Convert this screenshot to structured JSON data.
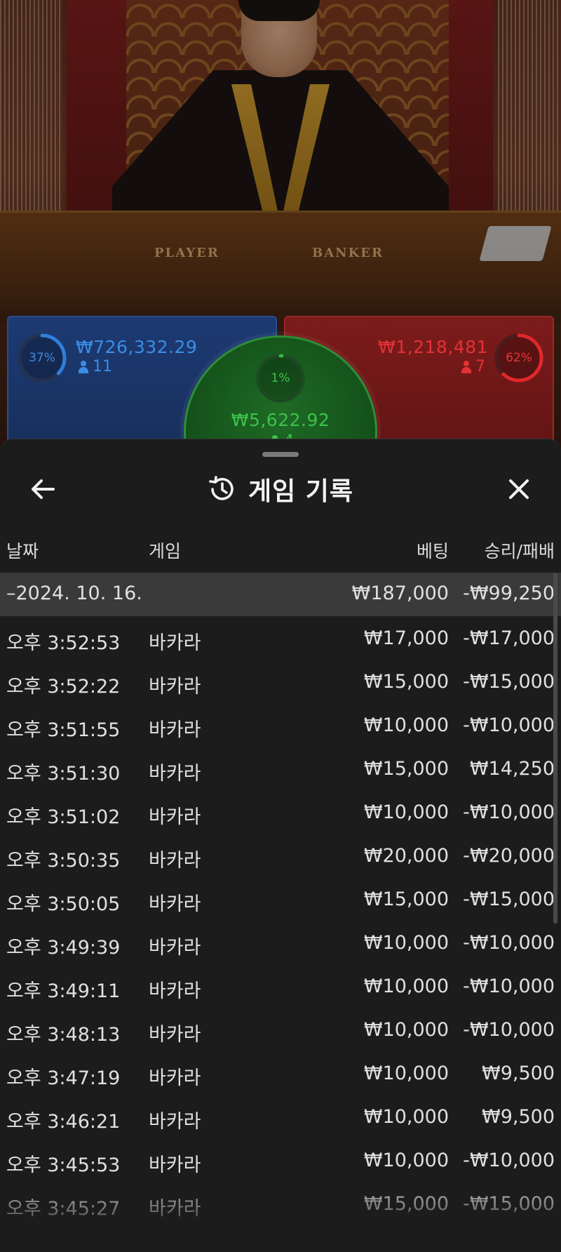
{
  "video": {
    "table_label_player": "PLAYER",
    "table_label_banker": "BANKER"
  },
  "bets": {
    "player": {
      "percent": "37%",
      "percent_value": 37,
      "amount": "₩726,332.29",
      "count": "11",
      "color": "#2f7fd9"
    },
    "tie": {
      "percent": "1%",
      "percent_value": 1,
      "amount": "₩5,622.92",
      "count": "4",
      "color": "#32b83e"
    },
    "banker": {
      "percent": "62%",
      "percent_value": 62,
      "amount": "₩1,218,481",
      "count": "7",
      "color": "#e0282c"
    }
  },
  "history": {
    "title": "게임 기록",
    "icons": {
      "back": "arrow-left-icon",
      "history": "history-clock-icon",
      "close": "close-icon"
    },
    "columns": {
      "date": "날짜",
      "game": "게임",
      "bet": "베팅",
      "winloss": "승리/패배"
    },
    "group": {
      "date": "–2024. 10. 16.",
      "bet": "₩187,000",
      "winloss": "-₩99,250"
    },
    "rows": [
      {
        "time": "오후 3:52:53",
        "game": "바카라",
        "bet": "₩17,000",
        "winloss": "-₩17,000"
      },
      {
        "time": "오후 3:52:22",
        "game": "바카라",
        "bet": "₩15,000",
        "winloss": "-₩15,000"
      },
      {
        "time": "오후 3:51:55",
        "game": "바카라",
        "bet": "₩10,000",
        "winloss": "-₩10,000"
      },
      {
        "time": "오후 3:51:30",
        "game": "바카라",
        "bet": "₩15,000",
        "winloss": "₩14,250"
      },
      {
        "time": "오후 3:51:02",
        "game": "바카라",
        "bet": "₩10,000",
        "winloss": "-₩10,000"
      },
      {
        "time": "오후 3:50:35",
        "game": "바카라",
        "bet": "₩20,000",
        "winloss": "-₩20,000"
      },
      {
        "time": "오후 3:50:05",
        "game": "바카라",
        "bet": "₩15,000",
        "winloss": "-₩15,000"
      },
      {
        "time": "오후 3:49:39",
        "game": "바카라",
        "bet": "₩10,000",
        "winloss": "-₩10,000"
      },
      {
        "time": "오후 3:49:11",
        "game": "바카라",
        "bet": "₩10,000",
        "winloss": "-₩10,000"
      },
      {
        "time": "오후 3:48:13",
        "game": "바카라",
        "bet": "₩10,000",
        "winloss": "-₩10,000"
      },
      {
        "time": "오후 3:47:19",
        "game": "바카라",
        "bet": "₩10,000",
        "winloss": "₩9,500"
      },
      {
        "time": "오후 3:46:21",
        "game": "바카라",
        "bet": "₩10,000",
        "winloss": "₩9,500"
      },
      {
        "time": "오후 3:45:53",
        "game": "바카라",
        "bet": "₩10,000",
        "winloss": "-₩10,000"
      },
      {
        "time": "오후 3:45:27",
        "game": "바카라",
        "bet": "₩15,000",
        "winloss": "-₩15,000"
      }
    ]
  }
}
